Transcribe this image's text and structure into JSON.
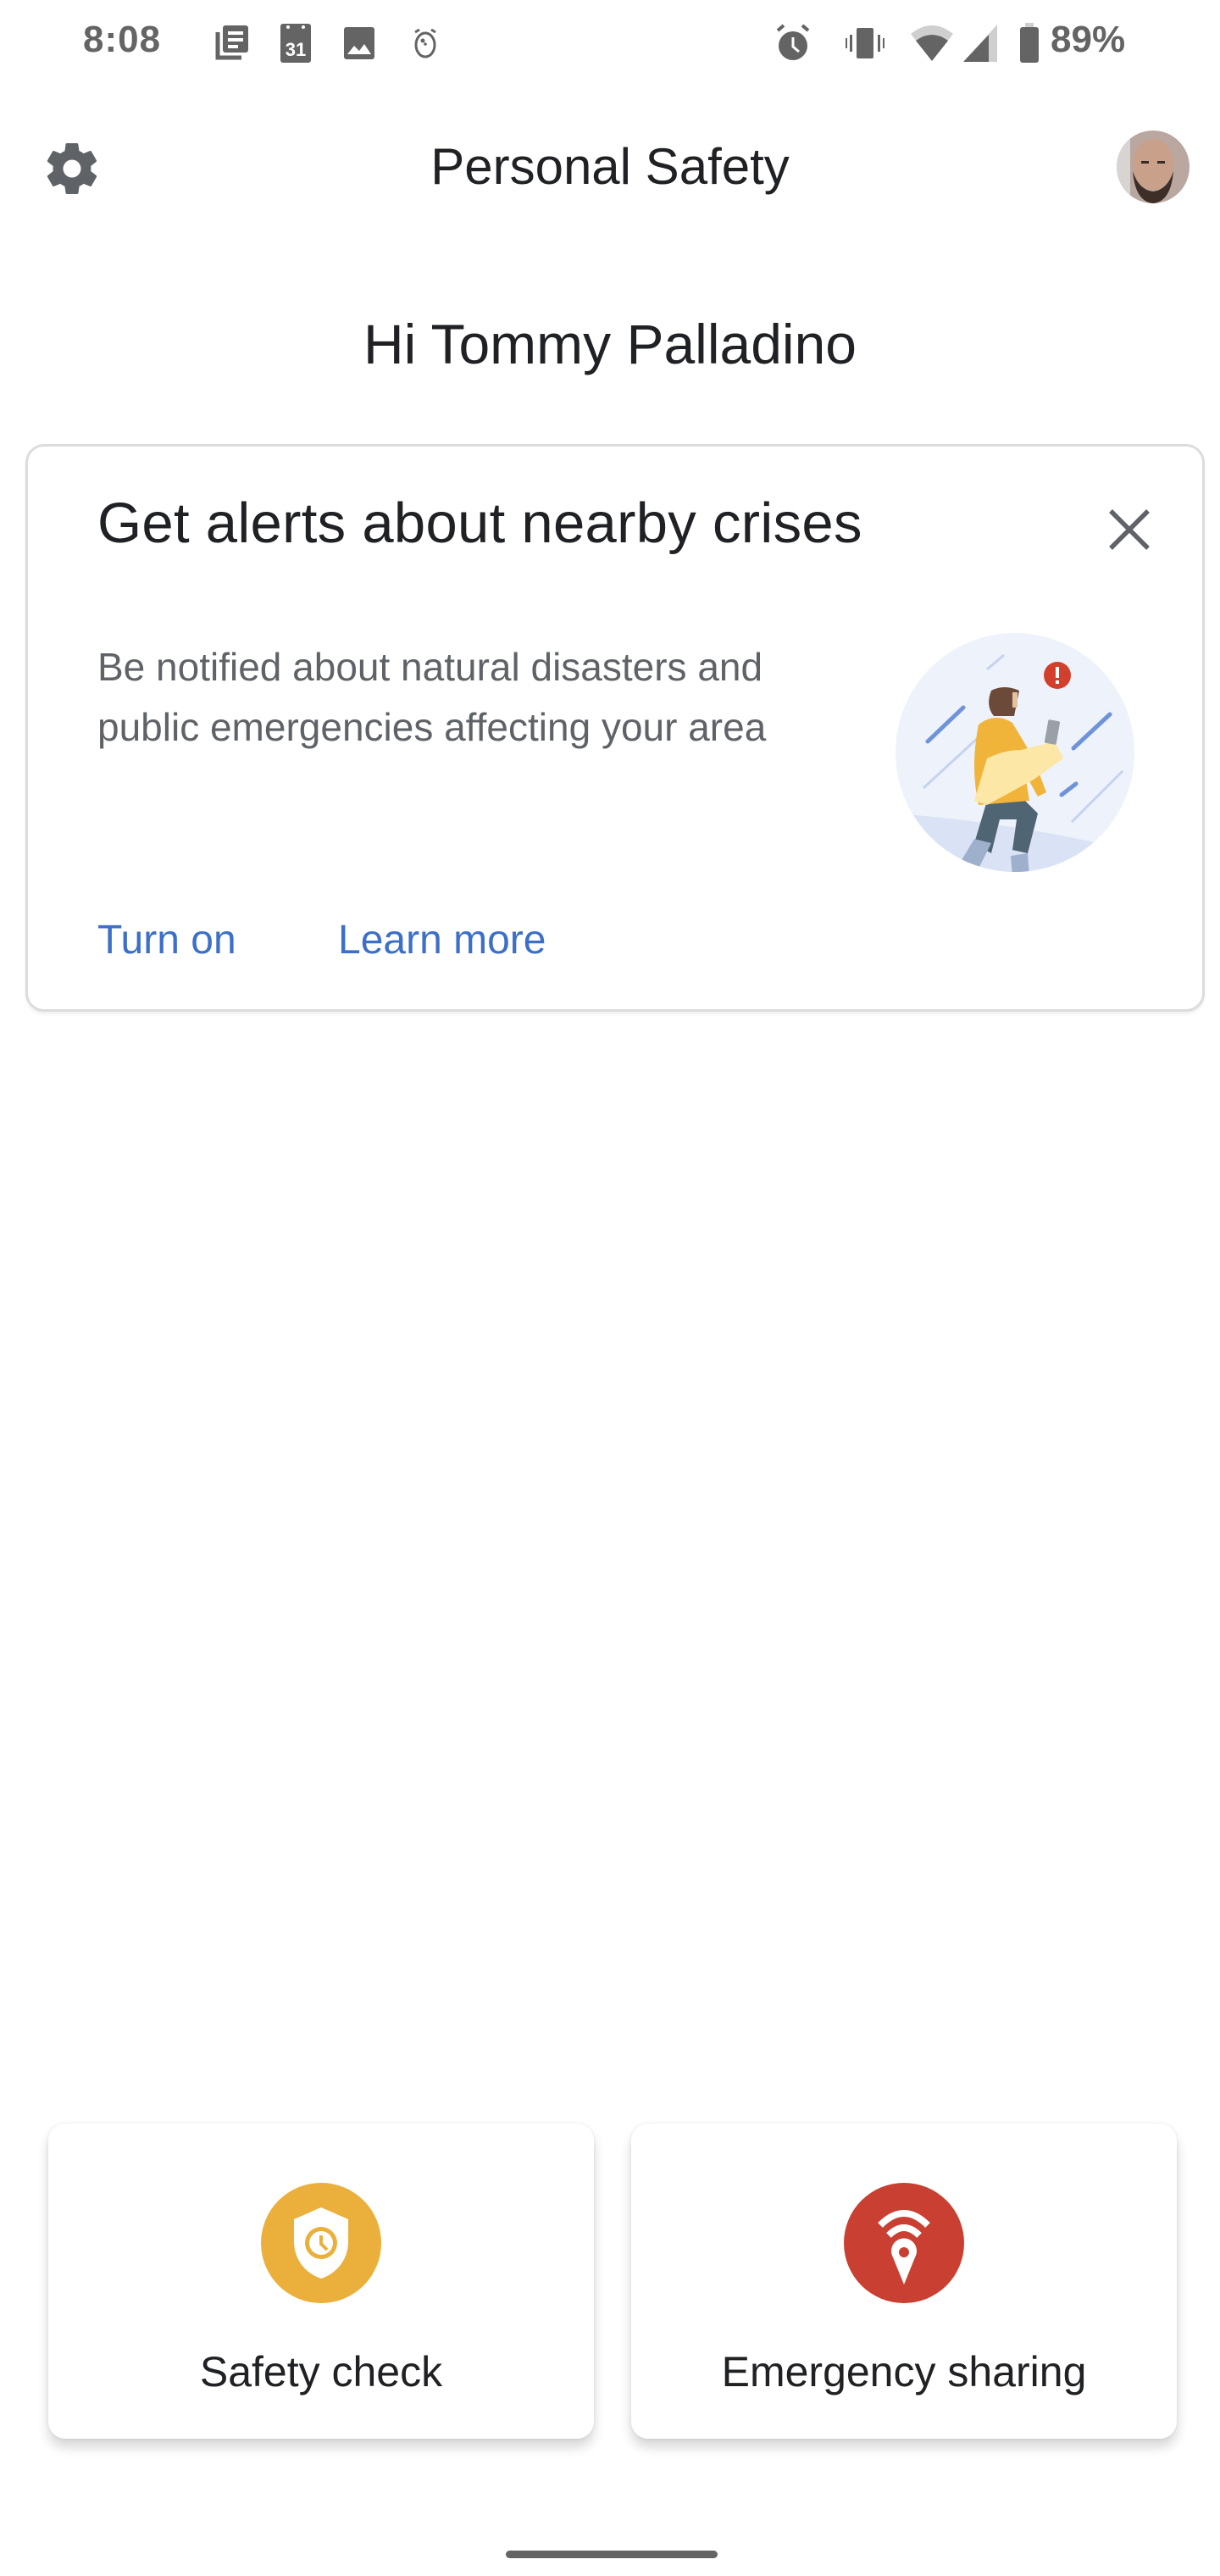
{
  "status_bar": {
    "time": "8:08",
    "left_icons": [
      "news-icon",
      "calendar-icon",
      "photo-icon",
      "bedtime-alarm-icon"
    ],
    "calendar_day": "31",
    "right_icons": [
      "alarm-icon",
      "vibrate-icon",
      "wifi-icon",
      "cell-signal-icon",
      "battery-icon"
    ],
    "battery_percent": "89%"
  },
  "header": {
    "title": "Personal Safety",
    "settings_icon": "gear-icon",
    "avatar": "user-avatar"
  },
  "greeting": "Hi Tommy Palladino",
  "alert_card": {
    "title": "Get alerts about nearby crises",
    "body": "Be notified about natural disasters and public emergencies affecting your area",
    "close_icon": "close-icon",
    "illustration": "person-with-phone-alert-illustration",
    "actions": [
      {
        "label": "Turn on"
      },
      {
        "label": "Learn more"
      }
    ],
    "link_color": "#3c6fc8"
  },
  "features": [
    {
      "label": "Safety check",
      "icon": "shield-clock-icon",
      "color": "#ebb03c"
    },
    {
      "label": "Emergency sharing",
      "icon": "location-broadcast-icon",
      "color": "#c94032"
    }
  ]
}
